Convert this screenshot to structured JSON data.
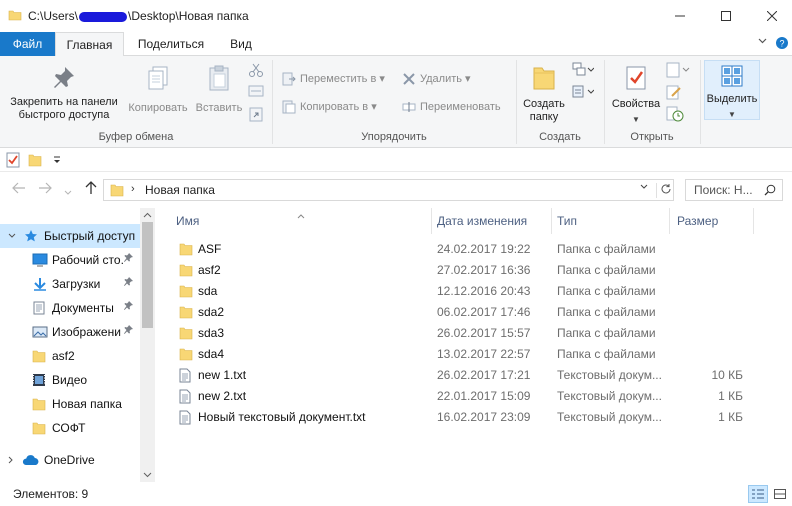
{
  "window": {
    "title_path_start": "C:\\Users\\",
    "title_path_end": "\\Desktop\\Новая папка"
  },
  "tabs": {
    "file": "Файл",
    "home": "Главная",
    "share": "Поделиться",
    "view": "Вид"
  },
  "ribbon": {
    "clipboard": {
      "pin": "Закрепить на панели быстрого доступа",
      "copy": "Копировать",
      "paste": "Вставить",
      "group": "Буфер обмена"
    },
    "organize": {
      "move_to": "Переместить в",
      "copy_to": "Копировать в",
      "delete": "Удалить",
      "rename": "Переименовать",
      "group": "Упорядочить"
    },
    "new": {
      "new_folder": "Создать папку",
      "group": "Создать"
    },
    "open": {
      "properties": "Свойства",
      "group": "Открыть"
    },
    "select": {
      "select": "Выделить"
    }
  },
  "address": {
    "path": "Новая папка",
    "search_placeholder": "Поиск: Н..."
  },
  "nav": {
    "items": [
      {
        "label": "Быстрый доступ",
        "icon": "star-icon"
      },
      {
        "label": "Рабочий сто.",
        "icon": "desktop-icon",
        "pinned": true
      },
      {
        "label": "Загрузки",
        "icon": "download-icon",
        "pinned": true
      },
      {
        "label": "Документы",
        "icon": "document-icon",
        "pinned": true
      },
      {
        "label": "Изображени",
        "icon": "image-icon",
        "pinned": true
      },
      {
        "label": "asf2",
        "icon": "folder-icon"
      },
      {
        "label": "Видео",
        "icon": "video-icon"
      },
      {
        "label": "Новая папка",
        "icon": "folder-icon"
      },
      {
        "label": "СОФТ",
        "icon": "folder-icon"
      },
      {
        "label": "OneDrive",
        "icon": "cloud-icon"
      }
    ]
  },
  "columns": {
    "name": "Имя",
    "date": "Дата изменения",
    "type": "Тип",
    "size": "Размер"
  },
  "files": [
    {
      "name": "ASF",
      "date": "24.02.2017 19:22",
      "type": "Папка с файлами",
      "size": "",
      "kind": "folder"
    },
    {
      "name": "asf2",
      "date": "27.02.2017 16:36",
      "type": "Папка с файлами",
      "size": "",
      "kind": "folder"
    },
    {
      "name": "sda",
      "date": "12.12.2016 20:43",
      "type": "Папка с файлами",
      "size": "",
      "kind": "folder"
    },
    {
      "name": "sda2",
      "date": "06.02.2017 17:46",
      "type": "Папка с файлами",
      "size": "",
      "kind": "folder"
    },
    {
      "name": "sda3",
      "date": "26.02.2017 15:57",
      "type": "Папка с файлами",
      "size": "",
      "kind": "folder"
    },
    {
      "name": "sda4",
      "date": "13.02.2017 22:57",
      "type": "Папка с файлами",
      "size": "",
      "kind": "folder"
    },
    {
      "name": "new 1.txt",
      "date": "26.02.2017 17:21",
      "type": "Текстовый докум...",
      "size": "10 КБ",
      "kind": "file"
    },
    {
      "name": "new 2.txt",
      "date": "22.01.2017 15:09",
      "type": "Текстовый докум...",
      "size": "1 КБ",
      "kind": "file"
    },
    {
      "name": "Новый текстовый документ.txt",
      "date": "16.02.2017 23:09",
      "type": "Текстовый докум...",
      "size": "1 КБ",
      "kind": "file"
    }
  ],
  "status": {
    "items": "Элементов: 9"
  },
  "colors": {
    "accent": "#1979ca",
    "selection": "#cce8ff",
    "folder": "#f8d775"
  }
}
